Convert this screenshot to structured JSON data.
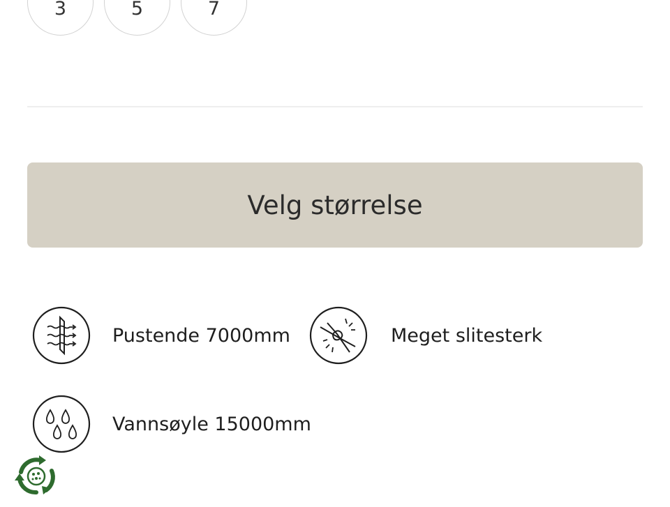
{
  "size_selector": {
    "options": [
      "3",
      "5",
      "7"
    ]
  },
  "cta": {
    "label": "Velg størrelse"
  },
  "features": [
    {
      "label": "Pustende 7000mm",
      "icon": "breathable-fabric-icon"
    },
    {
      "label": "Meget slitesterk",
      "icon": "durable-fabric-icon"
    },
    {
      "label": "Vannsøyle 15000mm",
      "icon": "water-drops-icon"
    }
  ],
  "eco_badge": {
    "icon": "recycle-eco-icon"
  },
  "colors": {
    "button_bg": "#d5d0c4",
    "text": "#222222",
    "divider": "#eeeeee",
    "eco_green": "#2e6b2e"
  }
}
